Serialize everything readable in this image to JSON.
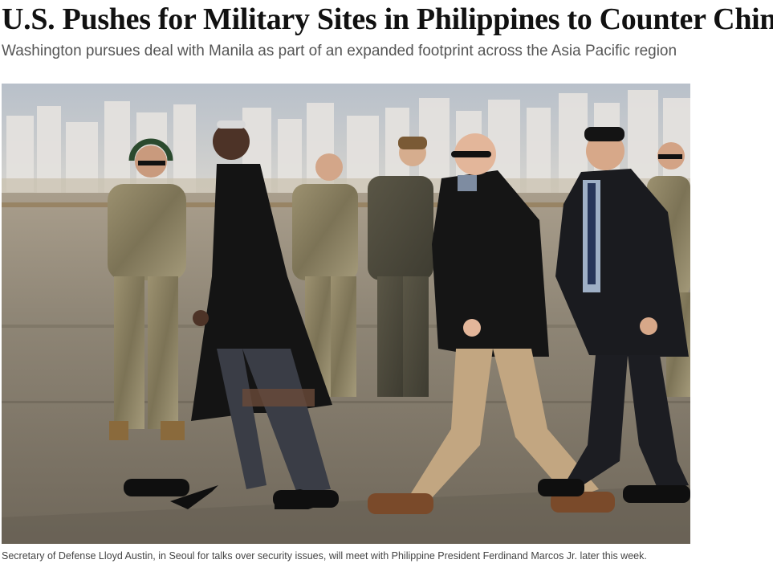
{
  "article": {
    "headline": "U.S. Pushes for Military Sites in Philippines to Counter China",
    "dek": "Washington pursues deal with Manila as part of an expanded footprint across the Asia Pacific region",
    "photo": {
      "caption": "Secretary of Defense Lloyd Austin, in Seoul for talks over security issues, will meet with Philippine President Ferdinand Marcos Jr. later this week."
    }
  }
}
